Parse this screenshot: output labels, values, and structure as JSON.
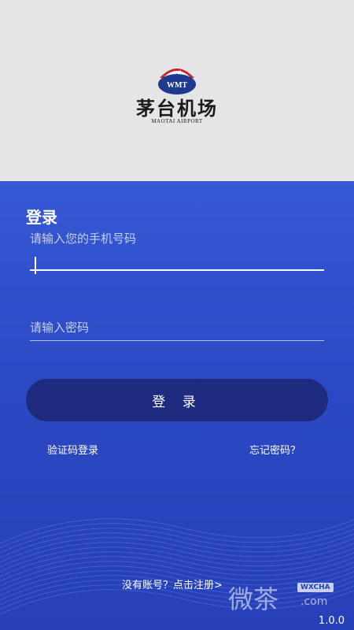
{
  "header": {
    "logo_emblem_text": "WMT",
    "logo_name_cn": "茅台机场",
    "logo_name_en": "MAOTAI AIRPORT"
  },
  "login": {
    "title": "登录",
    "phone_placeholder": "请输入您的手机号码",
    "password_placeholder": "请输入密码",
    "submit_label": "登 录",
    "sms_login_label": "验证码登录",
    "forgot_password_label": "忘记密码？",
    "register_label": "没有账号？点击注册>"
  },
  "footer": {
    "version": "1.0.0",
    "watermark_cn": "微茶",
    "watermark_badge": "WXCHA",
    "watermark_com": ".com"
  },
  "colors": {
    "panel_top": "#3559d3",
    "panel_bottom": "#2540b8",
    "button_bg": "#1f2b7e",
    "header_bg": "#e5e4e6"
  }
}
